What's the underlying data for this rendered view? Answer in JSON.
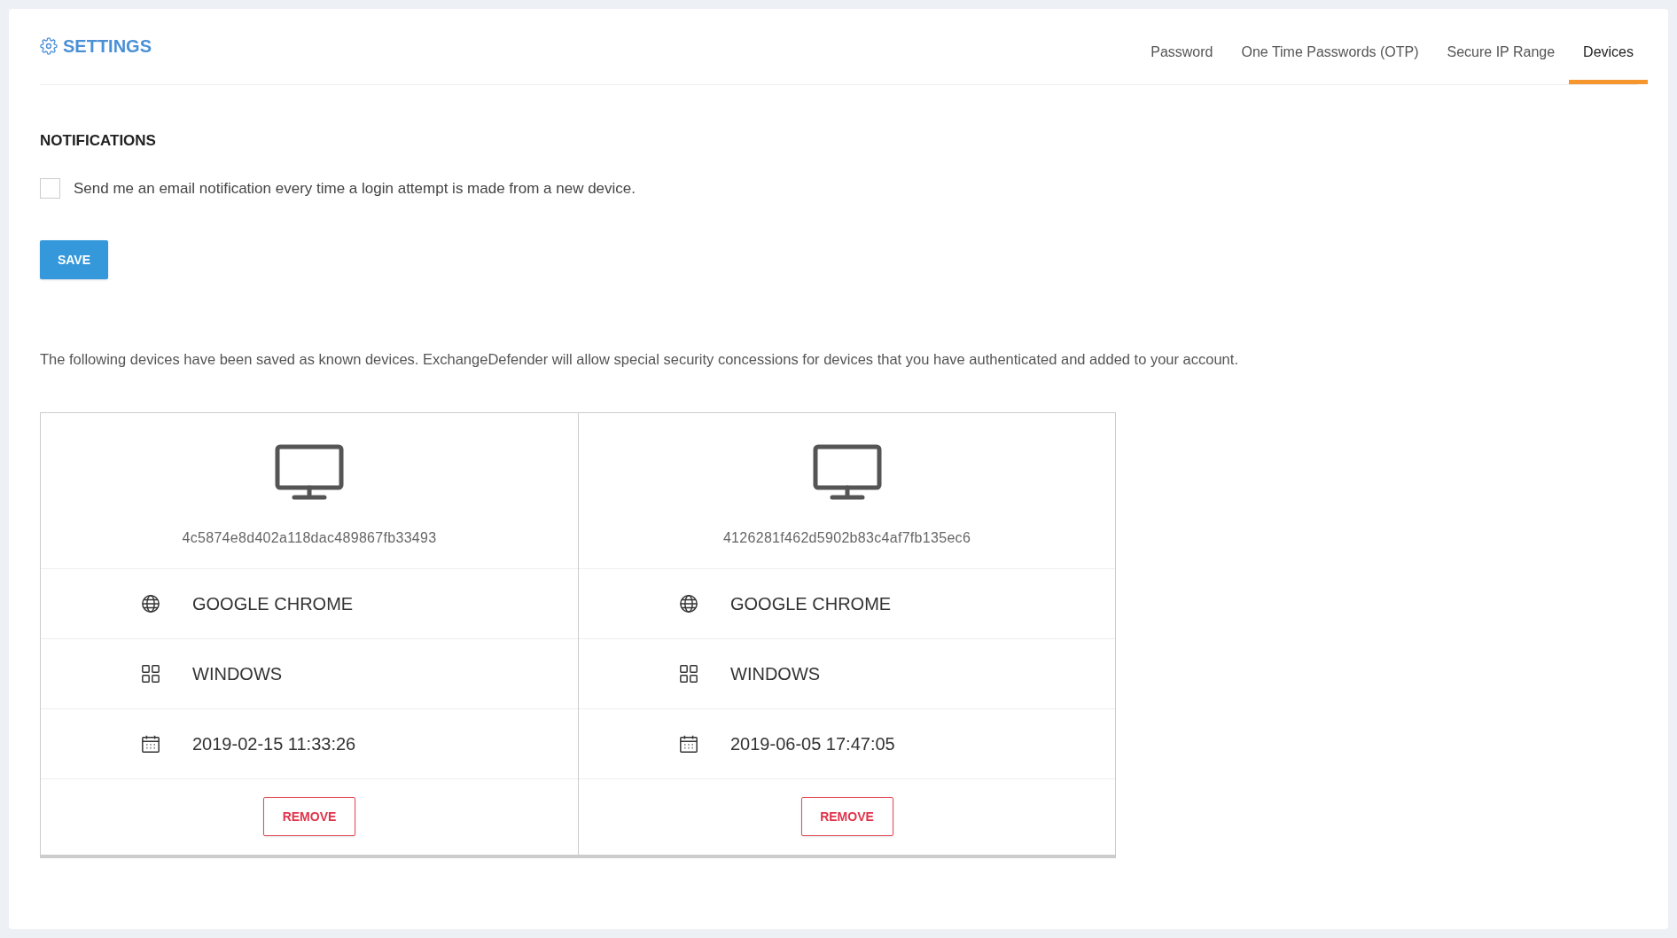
{
  "header": {
    "title": "SETTINGS"
  },
  "tabs": [
    {
      "label": "Password",
      "selected": false
    },
    {
      "label": "One Time Passwords (OTP)",
      "selected": false
    },
    {
      "label": "Secure IP Range",
      "selected": false
    },
    {
      "label": "Devices",
      "selected": true
    }
  ],
  "notifications": {
    "heading": "NOTIFICATIONS",
    "checkbox": {
      "label": "Send me an email notification every time a login attempt is made from a new device.",
      "checked": false
    },
    "save_button": "SAVE"
  },
  "description": "The following devices have been saved as known devices. ExchangeDefender will allow special security concessions for devices that you have authenticated and added to your account.",
  "devices": [
    {
      "id": "4c5874e8d402a118dac489867fb33493",
      "rows": [
        {
          "kind": "browser",
          "value": "GOOGLE CHROME"
        },
        {
          "kind": "os",
          "value": "WINDOWS"
        },
        {
          "kind": "date",
          "value": "2019-02-15 11:33:26"
        }
      ],
      "button": "REMOVE"
    },
    {
      "id": "4126281f462d5902b83c4af7fb135ec6",
      "rows": [
        {
          "kind": "browser",
          "value": "GOOGLE CHROME"
        },
        {
          "kind": "os",
          "value": "WINDOWS"
        },
        {
          "kind": "date",
          "value": "2019-06-05 17:47:05"
        }
      ],
      "button": "REMOVE"
    }
  ]
}
